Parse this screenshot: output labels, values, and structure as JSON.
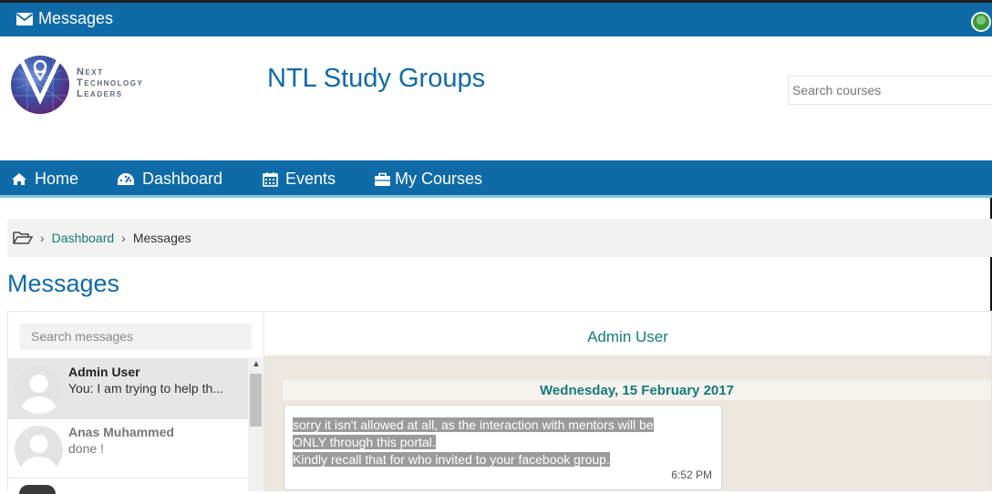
{
  "topbar": {
    "title": "Messages"
  },
  "header": {
    "logo_lines": [
      "Next",
      "Technology",
      "Leaders"
    ],
    "site_title": "NTL Study Groups",
    "search_placeholder": "Search courses"
  },
  "nav": [
    {
      "label": "Home",
      "icon": "home-icon"
    },
    {
      "label": "Dashboard",
      "icon": "dashboard-icon"
    },
    {
      "label": "Events",
      "icon": "calendar-icon"
    },
    {
      "label": "My Courses",
      "icon": "briefcase-icon"
    }
  ],
  "breadcrumb": {
    "link": "Dashboard",
    "current": "Messages"
  },
  "page_heading": "Messages",
  "messages": {
    "search_placeholder": "Search messages",
    "contacts": [
      {
        "name": "Admin User",
        "snippet": "You: I am trying to help th..."
      },
      {
        "name": "Anas Muhammed",
        "snippet": "done !"
      }
    ],
    "conversation": {
      "with": "Admin User",
      "date": "Wednesday, 15 February 2017",
      "message_lines": [
        "sorry it isn't allowed at all, as the interaction with mentors will be",
        "ONLY through this portal.",
        "Kindly recall that for who invited to your facebook group."
      ],
      "time": "6:52 PM"
    }
  }
}
